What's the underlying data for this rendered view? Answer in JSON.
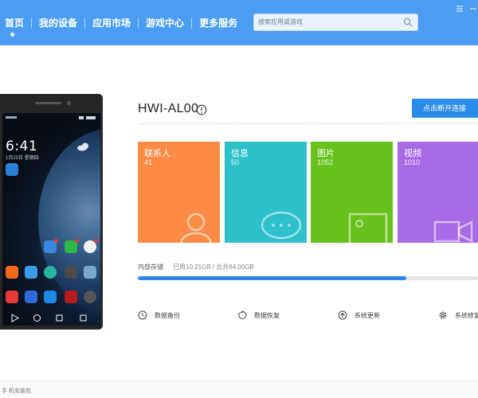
{
  "nav": {
    "tabs": [
      {
        "label": "首页"
      },
      {
        "label": "我的设备"
      },
      {
        "label": "应用市场"
      },
      {
        "label": "游戏中心"
      },
      {
        "label": "更多服务"
      }
    ],
    "active_index": 0
  },
  "search": {
    "placeholder": "搜索应用或游戏"
  },
  "window": {
    "icons": [
      "menu-icon",
      "minimize-icon"
    ]
  },
  "phone": {
    "time": "6:41",
    "date": "1月23日 星期四"
  },
  "device": {
    "name": "HWI-AL00",
    "connect_label": "点击断开连接"
  },
  "tiles": [
    {
      "label": "联系人",
      "count": "41",
      "color": "#fc8c45",
      "icon": "contact-icon"
    },
    {
      "label": "信息",
      "count": "50",
      "color": "#2ec1cc",
      "icon": "message-icon"
    },
    {
      "label": "图片",
      "count": "1052",
      "color": "#68c21d",
      "icon": "image-icon"
    },
    {
      "label": "视频",
      "count": "1010",
      "color": "#a86be6",
      "icon": "video-icon"
    }
  ],
  "storage": {
    "label": "内部存储",
    "used_text": "已用10.21GB / 总共64.00GB",
    "fill_fraction": 0.79
  },
  "actions": [
    {
      "label": "数据备份",
      "icon": "backup-icon"
    },
    {
      "label": "数据恢复",
      "icon": "restore-icon"
    },
    {
      "label": "系统更新",
      "icon": "update-icon"
    },
    {
      "label": "系统修复",
      "icon": "gear-icon"
    }
  ],
  "status": {
    "text": "手 机安装包"
  },
  "colors": {
    "accent": "#4a9df2",
    "button": "#2b8be8",
    "progress": "#2d89ea"
  }
}
